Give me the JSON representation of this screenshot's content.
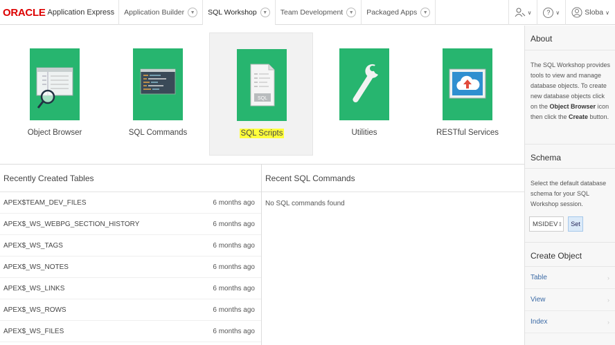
{
  "nav": {
    "brand_oracle": "ORACLE",
    "brand_app": "Application Express",
    "tabs": [
      {
        "label": "Application Builder"
      },
      {
        "label": "SQL Workshop"
      },
      {
        "label": "Team Development"
      },
      {
        "label": "Packaged Apps"
      }
    ],
    "user": "Sloba"
  },
  "tiles": [
    {
      "label": "Object Browser",
      "icon": "object-browser-icon"
    },
    {
      "label": "SQL Commands",
      "icon": "sql-commands-icon"
    },
    {
      "label": "SQL Scripts",
      "icon": "sql-scripts-icon",
      "highlighted": true
    },
    {
      "label": "Utilities",
      "icon": "wrench-icon"
    },
    {
      "label": "RESTful Services",
      "icon": "cloud-upload-icon"
    }
  ],
  "recent_tables": {
    "title": "Recently Created Tables",
    "rows": [
      {
        "name": "APEX$TEAM_DEV_FILES",
        "ago": "6 months ago"
      },
      {
        "name": "APEX$_WS_WEBPG_SECTION_HISTORY",
        "ago": "6 months ago"
      },
      {
        "name": "APEX$_WS_TAGS",
        "ago": "6 months ago"
      },
      {
        "name": "APEX$_WS_NOTES",
        "ago": "6 months ago"
      },
      {
        "name": "APEX$_WS_LINKS",
        "ago": "6 months ago"
      },
      {
        "name": "APEX$_WS_ROWS",
        "ago": "6 months ago"
      },
      {
        "name": "APEX$_WS_FILES",
        "ago": "6 months ago"
      }
    ]
  },
  "recent_sql": {
    "title": "Recent SQL Commands",
    "empty": "No SQL commands found"
  },
  "sidebar": {
    "about_title": "About",
    "about_text_1": "The SQL Workshop provides tools to view and manage database objects. To create new database objects click on the ",
    "about_bold_1": "Object Browser",
    "about_text_2": " icon then click the ",
    "about_bold_2": "Create",
    "about_text_3": " button.",
    "schema_title": "Schema",
    "schema_text": "Select the default database schema for your SQL Workshop session.",
    "schema_value": "MSIDEV",
    "set_label": "Set",
    "create_title": "Create Object",
    "create_links": [
      "Table",
      "View",
      "Index"
    ]
  },
  "colors": {
    "tile_green": "#27b56f",
    "brand_red": "#dd0000",
    "highlight": "#ffff3c",
    "link": "#3b6aa5"
  }
}
